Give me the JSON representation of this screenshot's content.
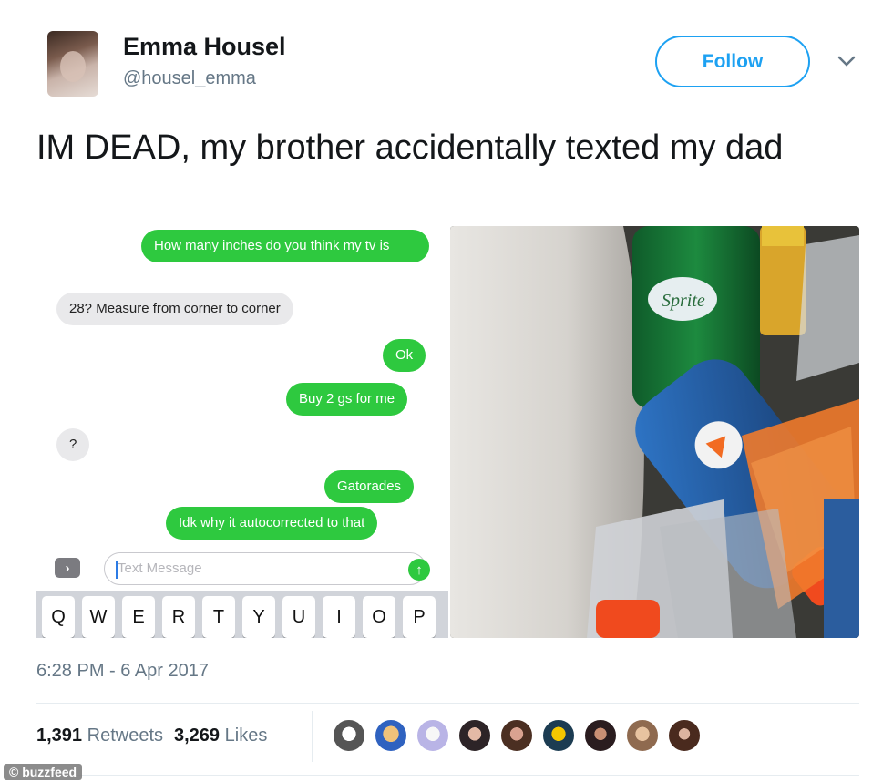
{
  "tweet": {
    "author_name": "Emma Housel",
    "author_handle": "@housel_emma",
    "follow_label": "Follow",
    "text": "IM DEAD, my brother accidentally texted my dad",
    "timestamp": "6:28 PM - 6 Apr 2017",
    "retweets_count": "1,391",
    "retweets_label": "Retweets",
    "likes_count": "3,269",
    "likes_label": "Likes"
  },
  "conversation": {
    "messages": [
      {
        "from": "sent",
        "text": "How many inches do you think my tv is"
      },
      {
        "from": "received",
        "text": "28? Measure from corner to corner"
      },
      {
        "from": "sent",
        "text": "Ok"
      },
      {
        "from": "sent",
        "text": "Buy 2 gs for me"
      },
      {
        "from": "received",
        "text": "?"
      },
      {
        "from": "sent",
        "text": "Gatorades"
      },
      {
        "from": "sent",
        "text": "Idk why it autocorrected to that"
      }
    ],
    "input_placeholder": "Text Message",
    "keyboard_keys": [
      "Q",
      "W",
      "E",
      "R",
      "T",
      "Y",
      "U",
      "I",
      "O",
      "P"
    ]
  },
  "photo": {
    "bottle_label": "Sprite"
  },
  "watermark": "© buzzfeed",
  "colors": {
    "accent": "#1da1f2",
    "imessage_green": "#2ec93f",
    "received_gray": "#e9e9eb",
    "secondary_text": "#657786"
  }
}
